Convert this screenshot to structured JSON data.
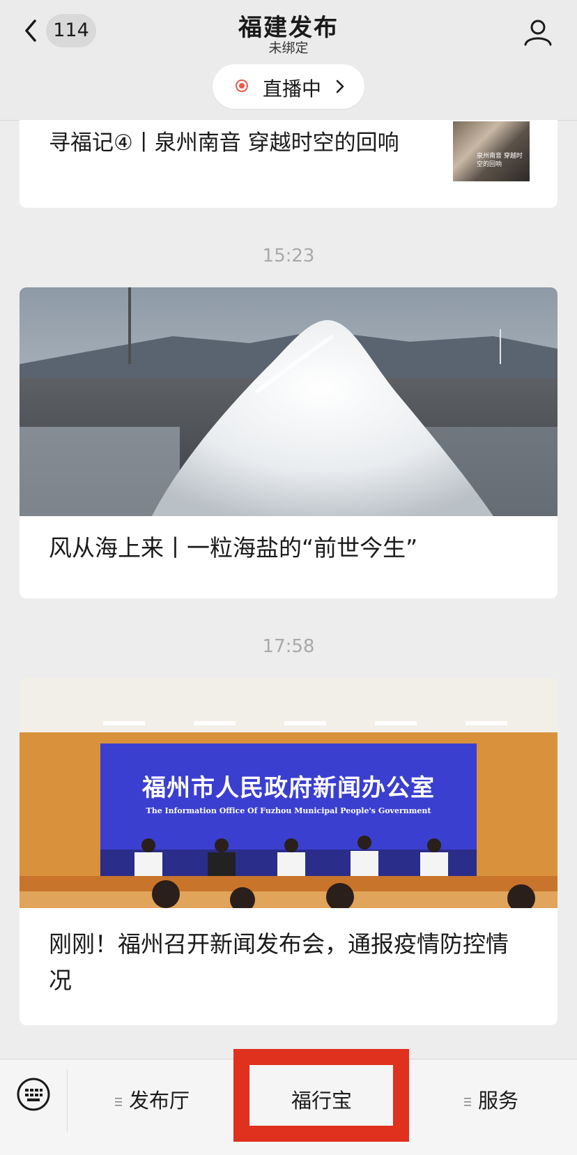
{
  "header": {
    "badge_count": "114",
    "title": "福建发布",
    "subtitle": "未绑定",
    "live_label": "直播中"
  },
  "feed": {
    "card1": {
      "title": "寻福记④丨泉州南音 穿越时空的回响",
      "thumb_caption": "泉州南音 穿越时空的回响"
    },
    "timestamp1": "15:23",
    "card2": {
      "title": "风从海上来丨一粒海盐的“前世今生”"
    },
    "timestamp2": "17:58",
    "card3": {
      "screen_title": "福州市人民政府新闻办公室",
      "screen_subtitle": "The Information Office Of Fuzhou Municipal People's Government",
      "title": "刚刚！福州召开新闻发布会，通报疫情防控情况"
    }
  },
  "bottom_menu": {
    "items": [
      {
        "label": "发布厅"
      },
      {
        "label": "福行宝"
      },
      {
        "label": "服务"
      }
    ]
  },
  "colors": {
    "live_dot": "#e8594b",
    "highlight_box": "#e0301e",
    "screen_blue": "#3b3fd0"
  },
  "icons": [
    "chevron-left-icon",
    "user-icon",
    "live-record-icon",
    "chevron-right-icon",
    "keyboard-icon",
    "menu-lines-icon"
  ]
}
